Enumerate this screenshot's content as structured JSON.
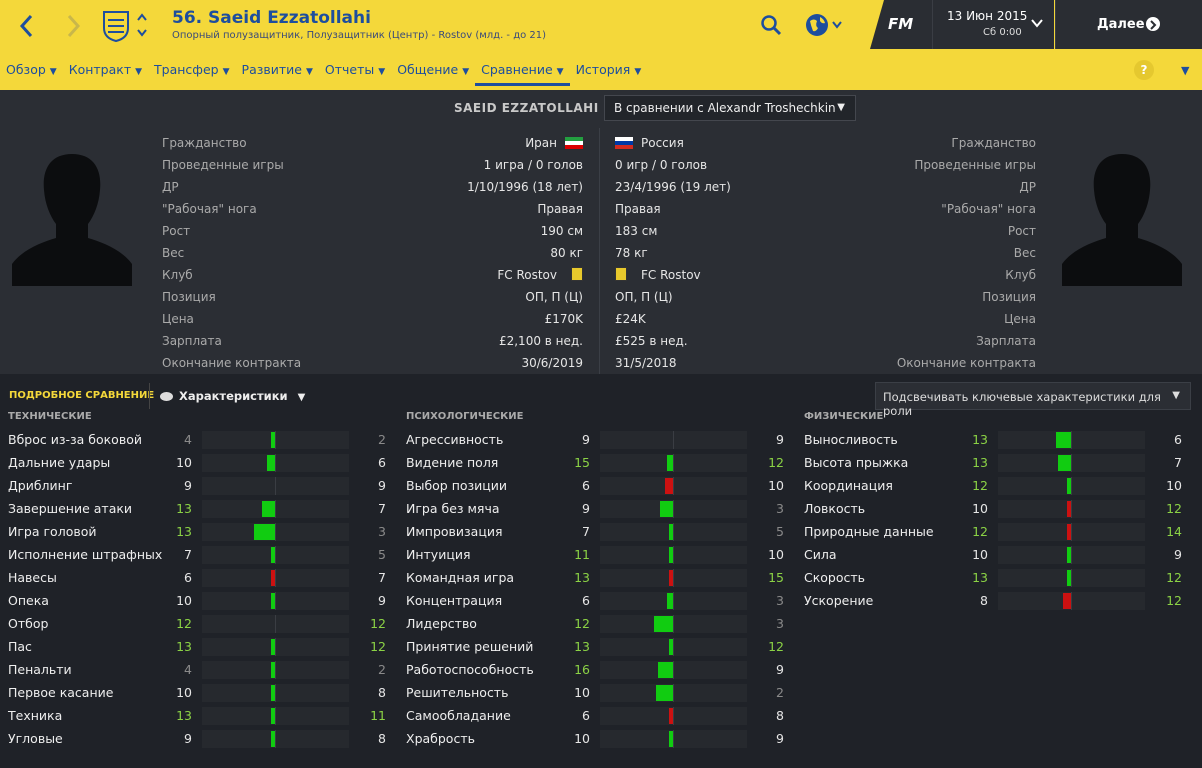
{
  "header": {
    "player_name": "56. Saeid Ezzatollahi",
    "player_subtitle": "Опорный полузащитник, Полузащитник (Центр) - Rostov (млд. - до 21)",
    "date": "13 Июн 2015",
    "time": "Сб 0:00",
    "next_label": "Далее",
    "fm_label": "FM"
  },
  "menu": {
    "items": [
      {
        "label": "Обзор"
      },
      {
        "label": "Контракт"
      },
      {
        "label": "Трансфер"
      },
      {
        "label": "Развитие"
      },
      {
        "label": "Отчеты"
      },
      {
        "label": "Общение"
      },
      {
        "label": "Сравнение",
        "active": true
      },
      {
        "label": "История"
      }
    ],
    "help": "?"
  },
  "compare": {
    "left_name": "SAEID EZZATOLLAHI",
    "selector": "В сравнении с Alexandr Troshechkin"
  },
  "info": {
    "labels": [
      "Гражданство",
      "Проведенные игры",
      "ДР",
      "\"Рабочая\" нога",
      "Рост",
      "Вес",
      "Клуб",
      "Позиция",
      "Цена",
      "Зарплата",
      "Окончание контракта"
    ],
    "left": [
      "Иран",
      "1 игра / 0 голов",
      "1/10/1996 (18 лет)",
      "Правая",
      "190 см",
      "80 кг",
      "FC Rostov",
      "ОП, П (Ц)",
      "£170K",
      "£2,100 в нед.",
      "30/6/2019"
    ],
    "right": [
      "Россия",
      "0 игр / 0 голов",
      "23/4/1996 (19 лет)",
      "Правая",
      "183 см",
      "78 кг",
      "FC Rostov",
      "ОП, П (Ц)",
      "£24K",
      "£525 в нед.",
      "31/5/2018"
    ]
  },
  "detail": {
    "label": "ПОДРОБНОЕ СРАВНЕНИЕ",
    "attr_selector": "Характеристики",
    "highlight_selector": "Подсвечивать ключевые характеристики для роли"
  },
  "sections": [
    {
      "title": "ТЕХНИЧЕСКИЕ",
      "rows": [
        {
          "name": "Вброс из-за боковой",
          "a": 4,
          "b": 2,
          "ac": "lo",
          "bc": "lo"
        },
        {
          "name": "Дальние удары",
          "a": 10,
          "b": 6,
          "ac": "n",
          "bc": "n"
        },
        {
          "name": "Дриблинг",
          "a": 9,
          "b": 9,
          "ac": "n",
          "bc": "n"
        },
        {
          "name": "Завершение атаки",
          "a": 13,
          "b": 7,
          "ac": "hi",
          "bc": "n"
        },
        {
          "name": "Игра головой",
          "a": 13,
          "b": 3,
          "ac": "hi",
          "bc": "lo"
        },
        {
          "name": "Исполнение штрафных",
          "a": 7,
          "b": 5,
          "ac": "n",
          "bc": "lo"
        },
        {
          "name": "Навесы",
          "a": 6,
          "b": 7,
          "ac": "n",
          "bc": "n"
        },
        {
          "name": "Опека",
          "a": 10,
          "b": 9,
          "ac": "n",
          "bc": "n"
        },
        {
          "name": "Отбор",
          "a": 12,
          "b": 12,
          "ac": "hi",
          "bc": "hi"
        },
        {
          "name": "Пас",
          "a": 13,
          "b": 12,
          "ac": "hi",
          "bc": "hi"
        },
        {
          "name": "Пенальти",
          "a": 4,
          "b": 2,
          "ac": "lo",
          "bc": "lo"
        },
        {
          "name": "Первое касание",
          "a": 10,
          "b": 8,
          "ac": "n",
          "bc": "n"
        },
        {
          "name": "Техника",
          "a": 13,
          "b": 11,
          "ac": "hi",
          "bc": "hi"
        },
        {
          "name": "Угловые",
          "a": 9,
          "b": 8,
          "ac": "n",
          "bc": "n"
        }
      ]
    },
    {
      "title": "ПСИХОЛОГИЧЕСКИЕ",
      "rows": [
        {
          "name": "Агрессивность",
          "a": 9,
          "b": 9,
          "ac": "n",
          "bc": "n"
        },
        {
          "name": "Видение поля",
          "a": 15,
          "b": 12,
          "ac": "hi",
          "bc": "hi"
        },
        {
          "name": "Выбор позиции",
          "a": 6,
          "b": 10,
          "ac": "n",
          "bc": "n"
        },
        {
          "name": "Игра без мяча",
          "a": 9,
          "b": 3,
          "ac": "n",
          "bc": "lo"
        },
        {
          "name": "Импровизация",
          "a": 7,
          "b": 5,
          "ac": "n",
          "bc": "lo"
        },
        {
          "name": "Интуиция",
          "a": 11,
          "b": 10,
          "ac": "hi",
          "bc": "n"
        },
        {
          "name": "Командная игра",
          "a": 13,
          "b": 15,
          "ac": "hi",
          "bc": "hi"
        },
        {
          "name": "Концентрация",
          "a": 6,
          "b": 3,
          "ac": "n",
          "bc": "lo"
        },
        {
          "name": "Лидерство",
          "a": 12,
          "b": 3,
          "ac": "hi",
          "bc": "lo"
        },
        {
          "name": "Принятие решений",
          "a": 13,
          "b": 12,
          "ac": "hi",
          "bc": "hi"
        },
        {
          "name": "Работоспособность",
          "a": 16,
          "b": 9,
          "ac": "hi",
          "bc": "n"
        },
        {
          "name": "Решительность",
          "a": 10,
          "b": 2,
          "ac": "n",
          "bc": "lo"
        },
        {
          "name": "Самообладание",
          "a": 6,
          "b": 8,
          "ac": "n",
          "bc": "n"
        },
        {
          "name": "Храбрость",
          "a": 10,
          "b": 9,
          "ac": "n",
          "bc": "n"
        }
      ]
    },
    {
      "title": "ФИЗИЧЕСКИЕ",
      "rows": [
        {
          "name": "Выносливость",
          "a": 13,
          "b": 6,
          "ac": "hi",
          "bc": "n"
        },
        {
          "name": "Высота прыжка",
          "a": 13,
          "b": 7,
          "ac": "hi",
          "bc": "n"
        },
        {
          "name": "Координация",
          "a": 12,
          "b": 10,
          "ac": "hi",
          "bc": "n"
        },
        {
          "name": "Ловкость",
          "a": 10,
          "b": 12,
          "ac": "n",
          "bc": "hi"
        },
        {
          "name": "Природные данные",
          "a": 12,
          "b": 14,
          "ac": "hi",
          "bc": "hi"
        },
        {
          "name": "Сила",
          "a": 10,
          "b": 9,
          "ac": "n",
          "bc": "n"
        },
        {
          "name": "Скорость",
          "a": 13,
          "b": 12,
          "ac": "hi",
          "bc": "hi"
        },
        {
          "name": "Ускорение",
          "a": 8,
          "b": 12,
          "ac": "n",
          "bc": "hi"
        }
      ]
    }
  ],
  "colors": {
    "accent": "#f4d83a",
    "link": "#1d4e9e",
    "good": "#11cc11",
    "bad": "#cc1111"
  }
}
